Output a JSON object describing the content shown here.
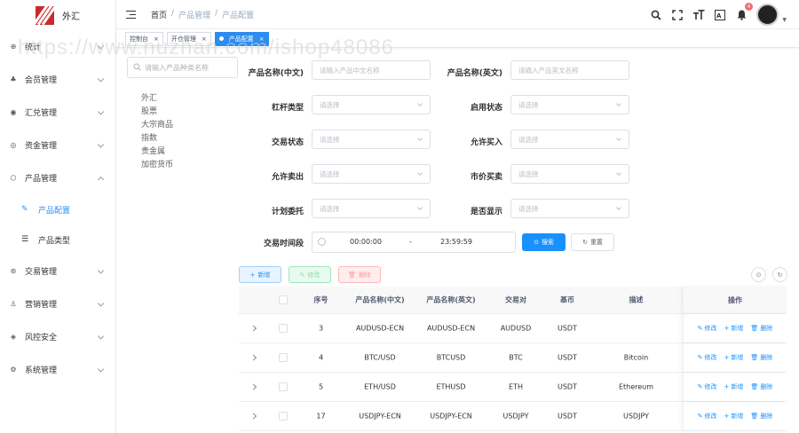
{
  "app": {
    "logo_text": "外汇"
  },
  "sidebar": {
    "items": [
      {
        "label": "统计",
        "icon": "dashboard-icon",
        "glyph": "⊕"
      },
      {
        "label": "会员管理",
        "icon": "users-icon",
        "glyph": "♣"
      },
      {
        "label": "汇兑管理",
        "icon": "exchange-icon",
        "glyph": "◉"
      },
      {
        "label": "资金管理",
        "icon": "funds-icon",
        "glyph": "◎"
      },
      {
        "label": "产品管理",
        "icon": "product-icon",
        "glyph": "⬡"
      }
    ],
    "sub_items": [
      {
        "label": "产品配置",
        "icon": "edit-icon",
        "glyph": "✎"
      },
      {
        "label": "产品类型",
        "icon": "list-icon",
        "glyph": "☰"
      }
    ],
    "items2": [
      {
        "label": "交易管理",
        "icon": "trade-icon",
        "glyph": "⊛"
      },
      {
        "label": "营销管理",
        "icon": "marketing-icon",
        "glyph": "♙"
      },
      {
        "label": "风控安全",
        "icon": "shield-icon",
        "glyph": "◈"
      },
      {
        "label": "系统管理",
        "icon": "settings-icon",
        "glyph": "⚙"
      }
    ]
  },
  "breadcrumb": {
    "home": "首页",
    "sep": "/",
    "level1": "产品管理",
    "level2": "产品配置"
  },
  "header": {
    "notification_count": "4"
  },
  "tags": [
    {
      "label": "控制台"
    },
    {
      "label": "开仓管理"
    },
    {
      "label": "产品配置"
    }
  ],
  "tree": {
    "search_placeholder": "请输入产品种类名称",
    "items": [
      "外汇",
      "股票",
      "大宗商品",
      "指数",
      "贵金属",
      "加密货币"
    ]
  },
  "form": {
    "name_cn_label": "产品名称(中文)",
    "name_cn_placeholder": "请输入产品中文名称",
    "name_en_label": "产品名称(英文)",
    "name_en_placeholder": "请输入产品英文名称",
    "leverage_label": "杠杆类型",
    "enabled_label": "启用状态",
    "trade_status_label": "交易状态",
    "allow_buy_label": "允许买入",
    "allow_sell_label": "允许卖出",
    "market_trade_label": "市价买卖",
    "plan_order_label": "计划委托",
    "show_label": "是否显示",
    "select_placeholder": "请选择",
    "time_label": "交易时间段",
    "time_start": "00:00:00",
    "time_sep": "-",
    "time_end": "23:59:59",
    "search_btn": "搜索",
    "reset_btn": "重置"
  },
  "toolbar": {
    "add": "新增",
    "edit": "修改",
    "delete": "删除"
  },
  "table": {
    "headers": {
      "index": "序号",
      "name_cn": "产品名称(中文)",
      "name_en": "产品名称(英文)",
      "pair": "交易对",
      "base": "基币",
      "desc": "描述",
      "ops": "操作"
    },
    "rows": [
      {
        "index": "3",
        "name_cn": "AUDUSD-ECN",
        "name_en": "AUDUSD-ECN",
        "pair": "AUDUSD",
        "base": "USDT",
        "desc": ""
      },
      {
        "index": "4",
        "name_cn": "BTC/USD",
        "name_en": "BTCUSD",
        "pair": "BTC",
        "base": "USDT",
        "desc": "Bitcoin"
      },
      {
        "index": "5",
        "name_cn": "ETH/USD",
        "name_en": "ETHUSD",
        "pair": "ETH",
        "base": "USDT",
        "desc": "Ethereum"
      },
      {
        "index": "17",
        "name_cn": "USDJPY-ECN",
        "name_en": "USDJPY-ECN",
        "pair": "USDJPY",
        "base": "USDT",
        "desc": "USDJPY"
      }
    ],
    "op_edit": "修改",
    "op_add": "新增",
    "op_delete": "删除"
  },
  "watermark": "https://www.huzhan.com/ishop48086",
  "colors": {
    "primary": "#1890ff",
    "brand": "#c92a2a",
    "active_tag": "#2d8cf0"
  }
}
